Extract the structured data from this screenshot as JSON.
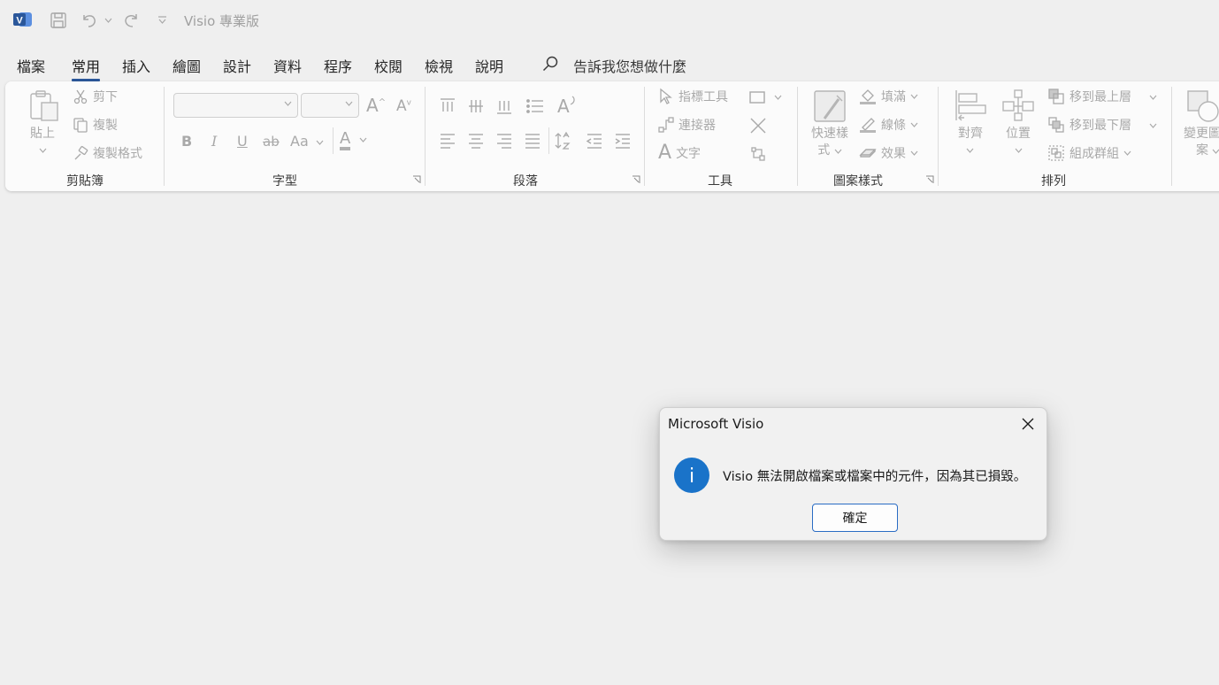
{
  "titlebar": {
    "logo_letter": "V",
    "title": "Visio 專業版"
  },
  "menu": {
    "tabs": [
      "檔案",
      "常用",
      "插入",
      "繪圖",
      "設計",
      "資料",
      "程序",
      "校閱",
      "檢視",
      "說明"
    ],
    "active_tab": "常用",
    "search_placeholder": "告訴我您想做什麼"
  },
  "ribbon": {
    "clipboard": {
      "label": "剪貼簿",
      "paste": "貼上",
      "cut": "剪下",
      "copy": "複製",
      "format_painter": "複製格式"
    },
    "font": {
      "label": "字型",
      "bold": "B",
      "italic": "I",
      "underline": "U",
      "strike": "ab",
      "change_case": "Aa",
      "font_color": "A",
      "grow": "A",
      "shrink": "A"
    },
    "paragraph": {
      "label": "段落",
      "text_dir": "A"
    },
    "tools": {
      "label": "工具",
      "pointer": "指標工具",
      "connector": "連接器",
      "text": "文字",
      "text_glyph": "A"
    },
    "shape_styles": {
      "label": "圖案樣式",
      "quick_styles": "快速樣式",
      "quick_styles_line1": "快速樣",
      "quick_styles_line2": "式",
      "fill": "填滿",
      "line": "線條",
      "effects": "效果"
    },
    "arrange": {
      "label": "排列",
      "align": "對齊",
      "position": "位置",
      "bring_front": "移到最上層",
      "send_back": "移到最下層",
      "group": "組成群組"
    },
    "change_shape": {
      "line1": "變更圖",
      "line2": "案"
    }
  },
  "dialog": {
    "title": "Microsoft Visio",
    "message": "Visio 無法開啟檔案或檔案中的元件，因為其已損毀。",
    "ok_label": "確定",
    "info_glyph": "i"
  },
  "colors": {
    "brand_blue": "#2b579a",
    "info_blue": "#1a73c9",
    "disabled_gray": "#a9a9a9"
  }
}
